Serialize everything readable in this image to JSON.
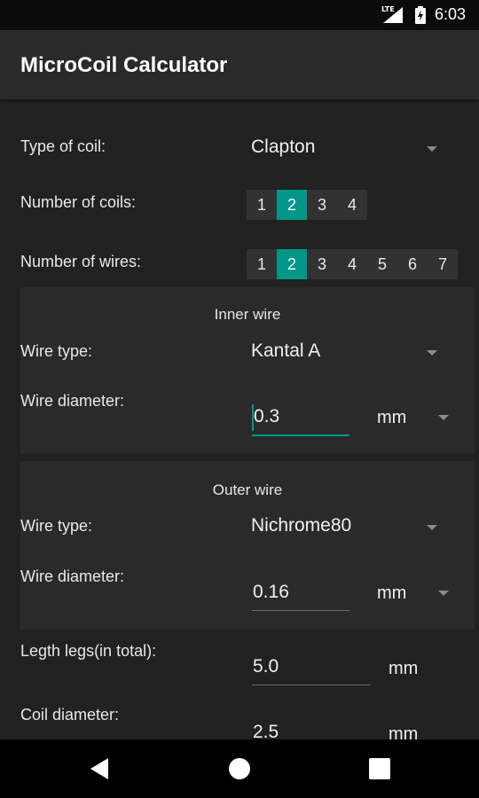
{
  "status_bar": {
    "network": "LTE",
    "time": "6:03"
  },
  "app_bar": {
    "title": "MicroCoil Calculator"
  },
  "coil_type": {
    "label": "Type of coil:",
    "value": "Clapton"
  },
  "num_coils": {
    "label": "Number of coils:",
    "options": [
      "1",
      "2",
      "3",
      "4"
    ],
    "selected": "2"
  },
  "num_wires": {
    "label": "Number of wires:",
    "options": [
      "1",
      "2",
      "3",
      "4",
      "5",
      "6",
      "7"
    ],
    "selected": "2"
  },
  "inner_wire": {
    "title": "Inner wire",
    "type_label": "Wire type:",
    "type_value": "Kantal A",
    "diameter_label": "Wire diameter:",
    "diameter_value": "0.3",
    "diameter_unit": "mm"
  },
  "outer_wire": {
    "title": "Outer wire",
    "type_label": "Wire type:",
    "type_value": "Nichrome80",
    "diameter_label": "Wire diameter:",
    "diameter_value": "0.16",
    "diameter_unit": "mm"
  },
  "legs_length": {
    "label": "Legth legs(in total):",
    "value": "5.0",
    "unit": "mm"
  },
  "coil_diameter": {
    "label": "Coil diameter:",
    "value": "2.5",
    "unit": "mm"
  },
  "colors": {
    "accent": "#009688",
    "background": "#212121",
    "panel": "#2a2a2a"
  },
  "nav_bar": {
    "icons": [
      "back-icon",
      "home-icon",
      "recents-icon"
    ]
  }
}
